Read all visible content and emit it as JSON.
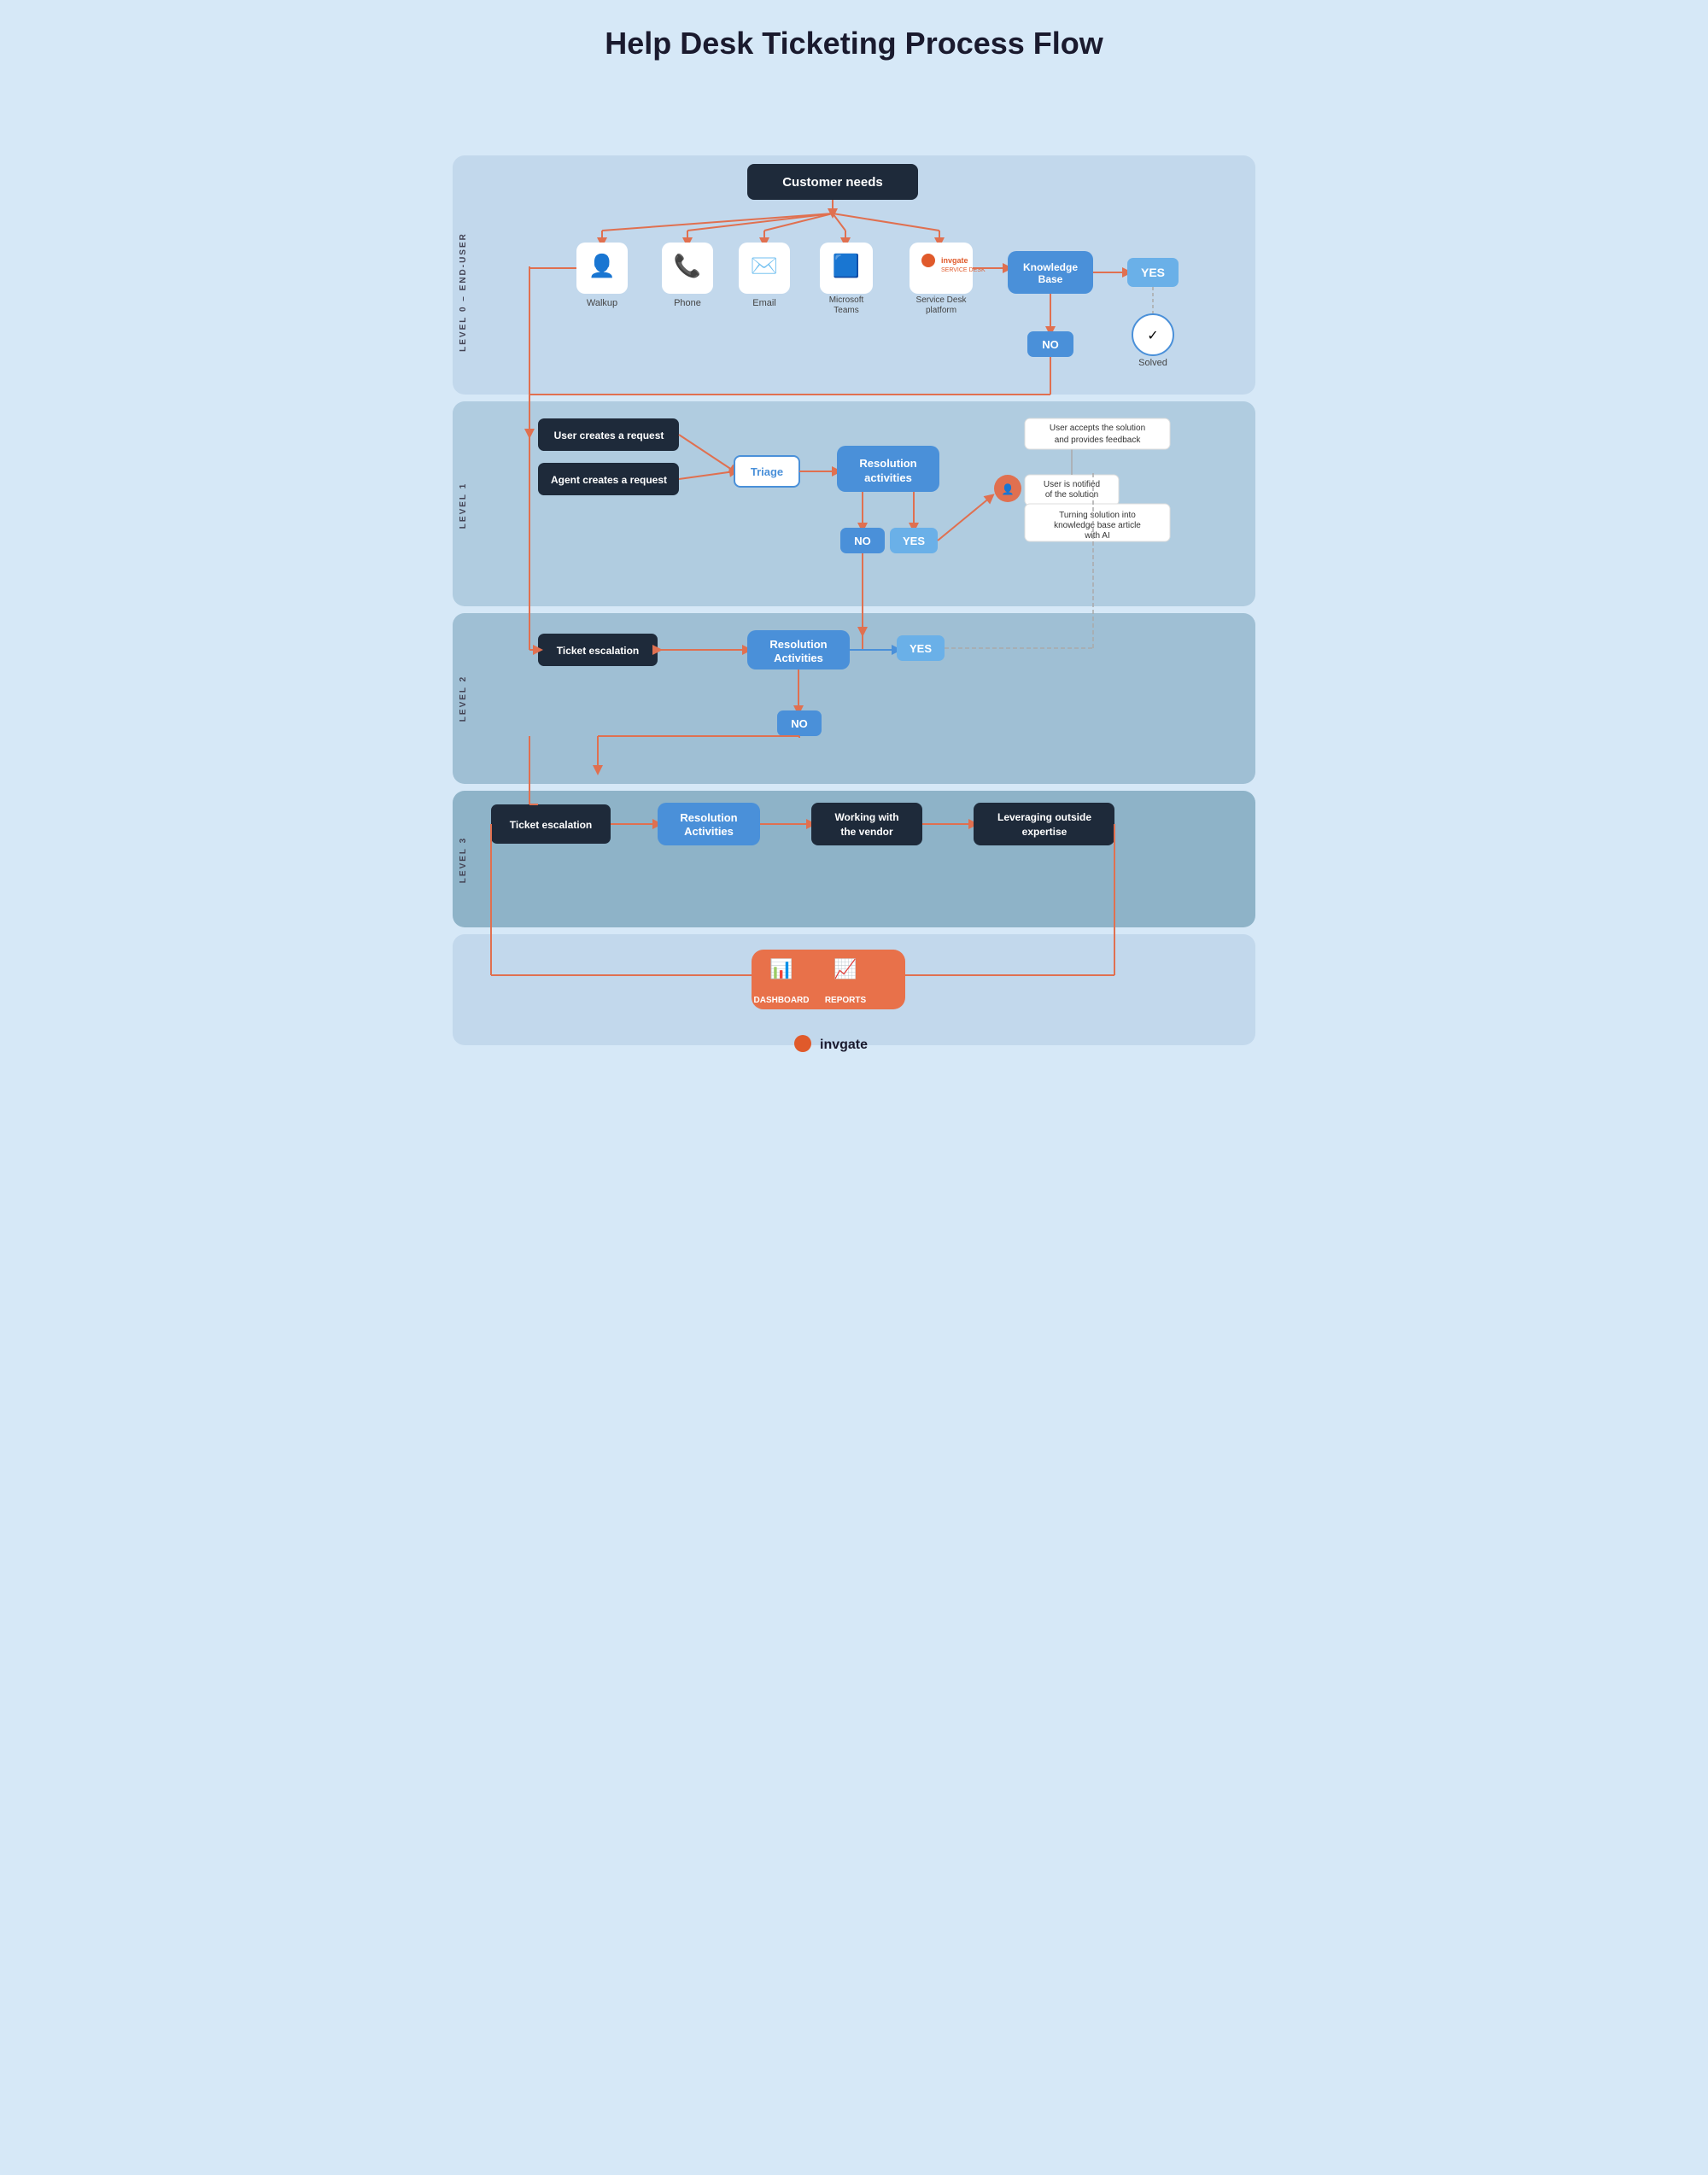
{
  "title": "Help Desk Ticketing Process Flow",
  "levels": {
    "level0": "LEVEL 0 – END-USER",
    "level1": "LEVEL 1",
    "level2": "LEVEL 2",
    "level3": "LEVEL 3"
  },
  "nodes": {
    "customer_needs": "Customer needs",
    "walkup": "Walkup",
    "phone": "Phone",
    "email": "Email",
    "microsoft_teams": "Microsoft Teams",
    "service_desk": "Service Desk platform",
    "knowledge_base": "Knowledge Base",
    "yes": "YES",
    "no": "NO",
    "solved": "Solved",
    "user_creates": "User creates a request",
    "agent_creates": "Agent creates a request",
    "triage": "Triage",
    "resolution_l1": "Resolution activities",
    "resolution_l2": "Resolution Activities",
    "resolution_l3": "Resolution Activities",
    "user_notified": "User is notified of the solution",
    "user_accepts": "User accepts the solution and provides feedback",
    "kb_article": "Turning solution into knowledge base article with AI",
    "ticket_esc_l2": "Ticket escalation",
    "ticket_esc_l3": "Ticket escalation",
    "working_vendor": "Working with the vendor",
    "leveraging": "Leveraging outside expertise"
  },
  "dashboard": {
    "label1": "DASHBOARD",
    "label2": "REPORTS"
  },
  "footer": {
    "brand": "invgate"
  }
}
